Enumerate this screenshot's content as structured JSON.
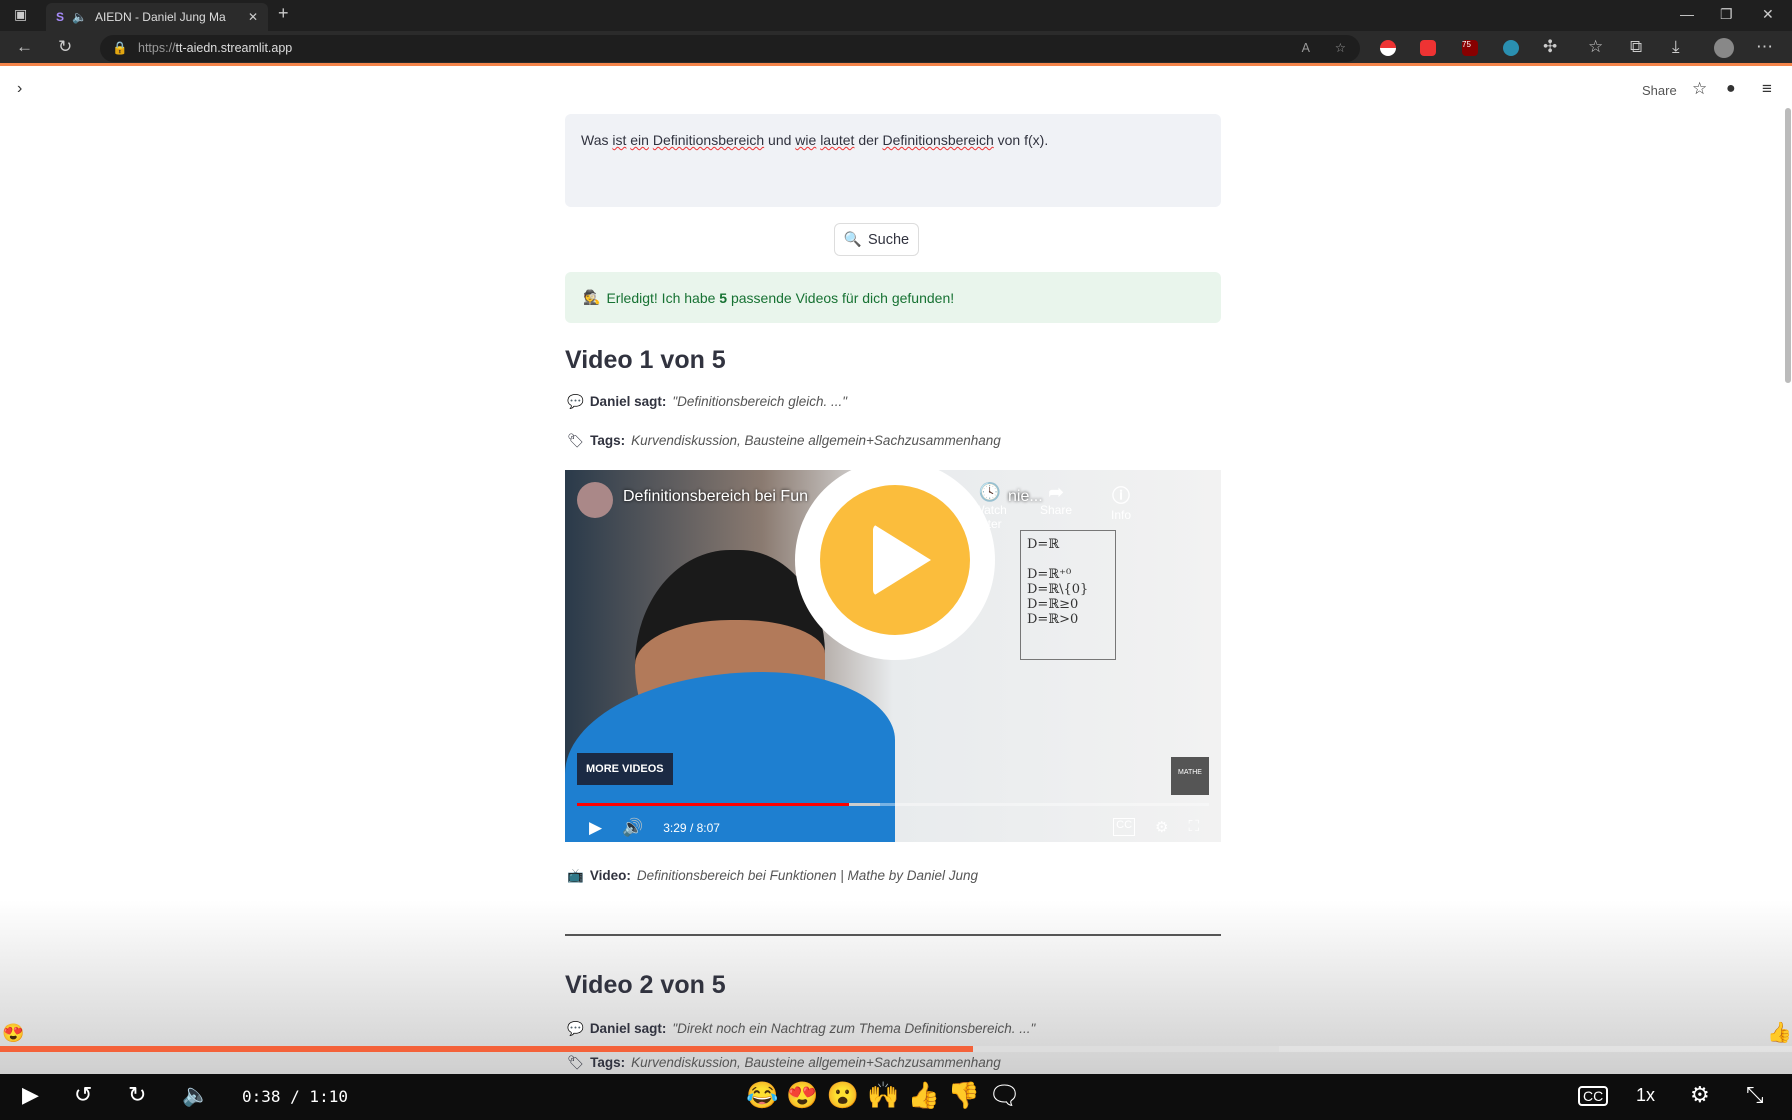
{
  "browser": {
    "tab_title": "AIEDN - Daniel Jung Ma",
    "url_scheme": "https://",
    "url_host": "tt-aiedn.streamlit.app",
    "ext_badge": "75"
  },
  "header": {
    "share": "Share"
  },
  "query": {
    "text_parts": [
      "Was ",
      "ist",
      " ",
      "ein",
      " ",
      "Definitionsbereich",
      " und ",
      "wie",
      " ",
      "lautet",
      " der ",
      "Definitionsbereich",
      " von f(x)."
    ]
  },
  "search_button": {
    "label": "Suche"
  },
  "success": {
    "prefix": "Erledigt! Ich habe ",
    "count": "5",
    "suffix": " passende Videos für dich gefunden!"
  },
  "videos": [
    {
      "heading": "Video 1 von 5",
      "says_label": "Daniel sagt:",
      "says": "\"Definitionsbereich gleich. ...\"",
      "tags_label": "Tags:",
      "tags": "Kurvendiskussion, Bausteine allgemein+Sachzusammenhang",
      "player": {
        "title": "Definitionsbereich bei Funktionen | Mathe by Daniel Jung",
        "title_shown": "Definitionsbereich bei Fun",
        "title_tail": "nie...",
        "watch_later": "Watch later",
        "share": "Share",
        "info": "Info",
        "more_videos": "MORE VIDEOS",
        "logo": "MATHE",
        "time": "3:29 / 8:07",
        "progress_percent": 43
      },
      "video_label": "Video:",
      "video_title": "Definitionsbereich bei Funktionen | Mathe by Daniel Jung"
    },
    {
      "heading": "Video 2 von 5",
      "says_label": "Daniel sagt:",
      "says": "\"Direkt noch ein Nachtrag zum Thema Definitionsbereich. ...\"",
      "tags_label": "Tags:",
      "tags": "Kurvendiskussion, Bausteine allgemein+Sachzusammenhang"
    }
  ],
  "outer_player": {
    "time": "0:38 / 1:10",
    "progress_percent": 54.3,
    "buffered_percent": 71.4,
    "speed": "1x",
    "reactions": [
      "😂",
      "😍",
      "😮",
      "🙌",
      "👍",
      "👎"
    ]
  },
  "colors": {
    "accent": "#f4623a",
    "play": "#fbbd3c",
    "success_bg": "#e9f5ec",
    "success_text": "#177233"
  }
}
